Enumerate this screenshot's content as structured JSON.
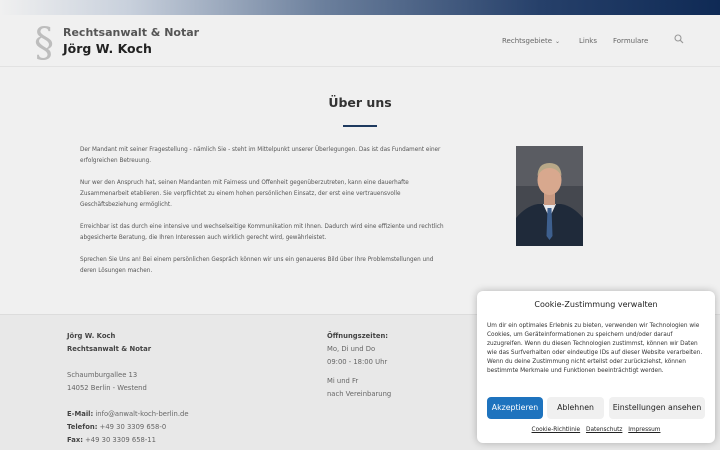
{
  "header": {
    "logo_symbol": "§",
    "line1": "Rechtsanwalt & Notar",
    "line2": "Jörg W. Koch",
    "nav": [
      {
        "label": "Rechtsgebiete",
        "has_dropdown": true
      },
      {
        "label": "Links"
      },
      {
        "label": "Formulare"
      }
    ],
    "search_icon": "search-icon",
    "chevron_icon": "chevron-down-icon"
  },
  "main": {
    "title": "Über uns",
    "paragraphs": [
      "Der Mandant mit seiner Fragestellung - nämlich Sie - steht im Mittelpunkt unserer Überlegungen. Das ist das Fundament einer erfolgreichen Betreuung.",
      "Nur wer den Anspruch hat, seinen Mandanten mit Fairness und Offenheit gegenüberzutreten, kann eine dauerhafte Zusammenarbeit etablieren. Sie verpflichtet zu einem hohen persönlichen Einsatz, der erst eine vertrauensvolle Geschäftsbeziehung ermöglicht.",
      "Erreichbar ist das durch eine intensive und wechselseitige Kommunikation mit Ihnen. Dadurch wird eine effiziente und rechtlich abgesicherte Beratung, die Ihren Interessen auch wirklich gerecht wird, gewährleistet.",
      "Sprechen Sie Uns an! Bei einem persönlichen Gespräch können wir uns ein genaueres Bild über Ihre Problemstellungen und deren Lösungen machen."
    ]
  },
  "footer": {
    "name": "Jörg W. Koch",
    "role": "Rechtsanwalt & Notar",
    "street": "Schaumburgallee 13",
    "city": "14052 Berlin - Westend",
    "email_label": "E-Mail:",
    "email": "info@anwalt-koch-berlin.de",
    "phone_label": "Telefon:",
    "phone": "+49 30 3309 658-0",
    "fax_label": "Fax:",
    "fax": "+49 30 3309 658-11",
    "hours_title": "Öffnungszeiten:",
    "hours_days1": "Mo, Di und Do",
    "hours_time1": "09:00 - 18:00 Uhr",
    "hours_days2": "Mi und Fr",
    "hours_time2": "nach Vereinbarung"
  },
  "cookie": {
    "title": "Cookie-Zustimmung verwalten",
    "text": "Um dir ein optimales Erlebnis zu bieten, verwenden wir Technologien wie Cookies, um Geräteinformationen zu speichern und/oder darauf zuzugreifen. Wenn du diesen Technologien zustimmst, können wir Daten wie das Surfverhalten oder eindeutige IDs auf dieser Website verarbeiten. Wenn du deine Zustimmung nicht erteilst oder zurückziehst, können bestimmte Merkmale und Funktionen beeinträchtigt werden.",
    "accept": "Akzeptieren",
    "decline": "Ablehnen",
    "settings": "Einstellungen ansehen",
    "links": [
      "Cookie-Richtlinie",
      "Datenschutz",
      "Impressum"
    ]
  },
  "colors": {
    "accent": "#1e73be",
    "header_gradient_dark": "#0f2a55",
    "title_rule": "#1e3a5f"
  }
}
